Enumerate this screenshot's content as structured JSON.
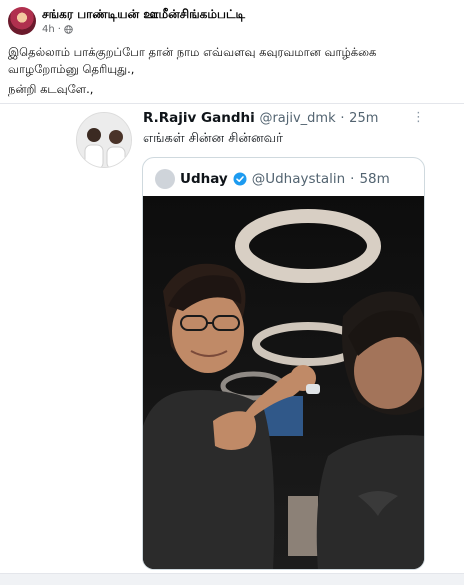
{
  "post": {
    "author": "சங்கர பாண்டியன் ஊமீன்சிங்கம்பட்டி",
    "time": "4h",
    "privacy_icon": "globe-icon",
    "lines": [
      "இதெல்லாம் பாக்குறப்போ தான் நாம எவ்வளவு கவுரவமான வாழ்க்கை",
      "வாழறோம்னு தெரியுது.,",
      "நன்றி கடவுளே.,"
    ]
  },
  "tweet": {
    "name": "R.Rajiv Gandhi",
    "handle": "@rajiv_dmk",
    "time": "25m",
    "text": "எங்கள் சின்ன சின்னவர்",
    "quote": {
      "name": "Udhay",
      "handle": "@Udhaystalin",
      "time": "58m",
      "verified_color": "#1d9bf0"
    }
  },
  "colors": {
    "accent": "#1d9bf0",
    "secondary_text": "#536471"
  }
}
